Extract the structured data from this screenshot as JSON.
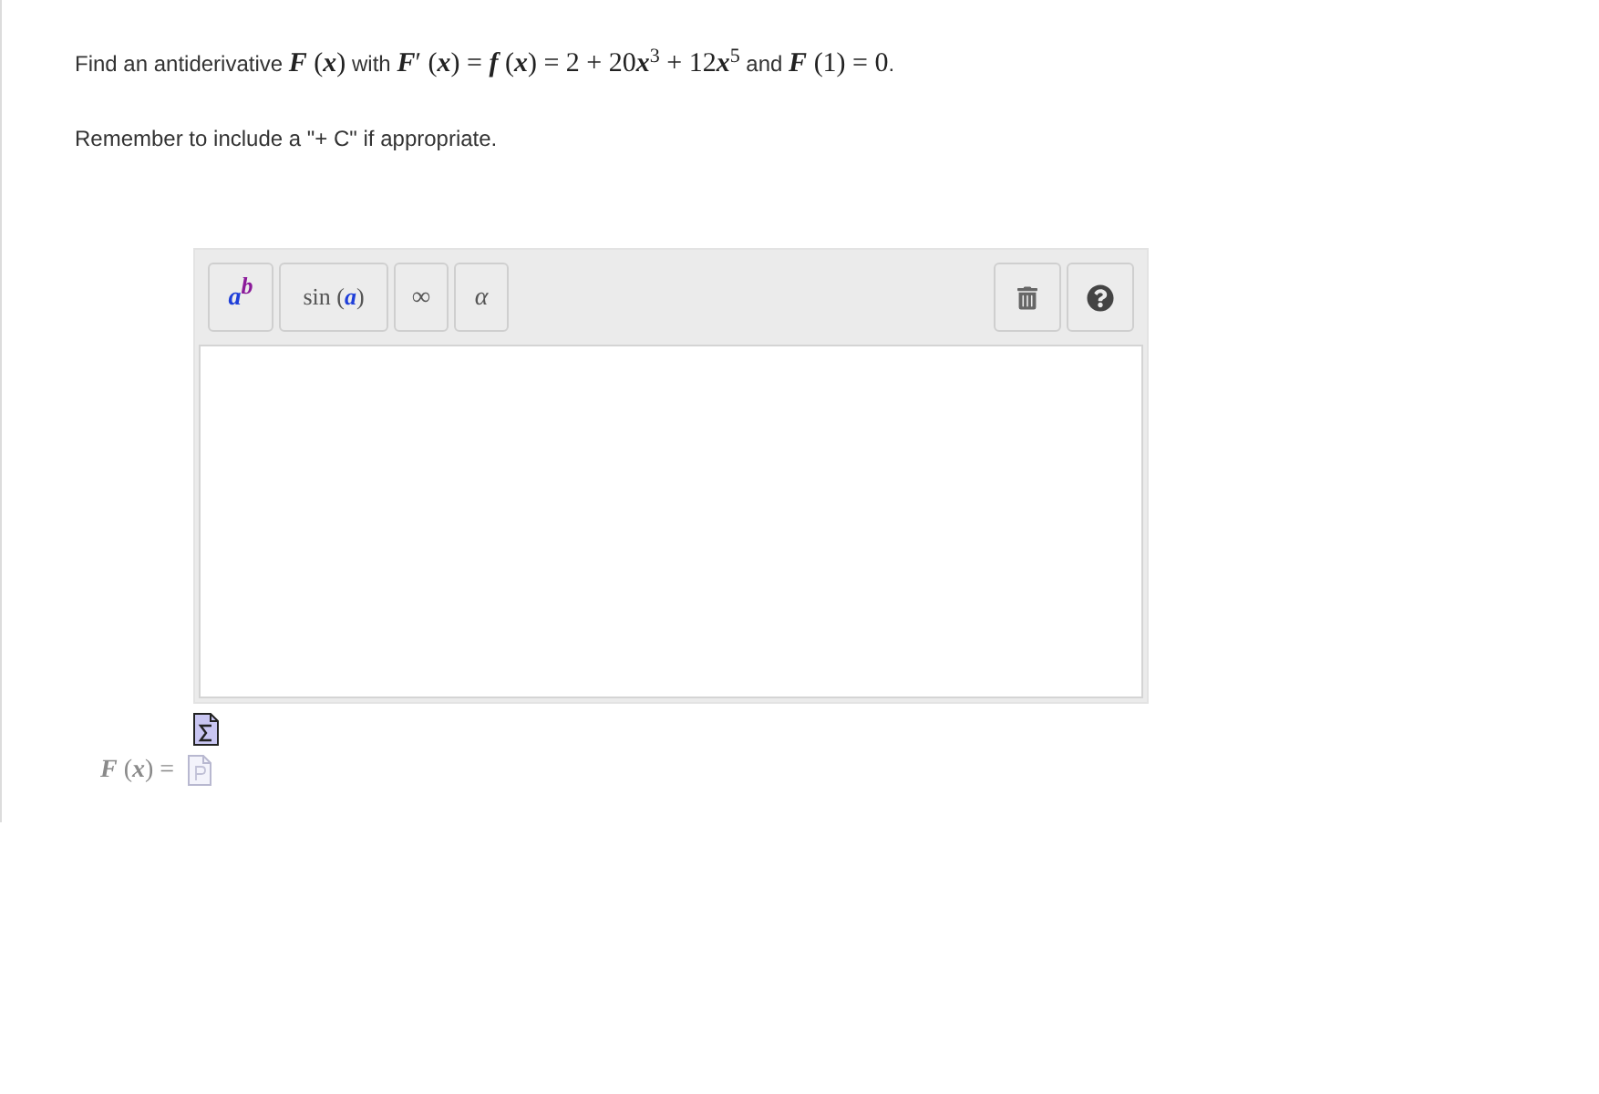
{
  "question": {
    "segments": [
      {
        "kind": "text",
        "text": "Find an antiderivative "
      },
      {
        "kind": "math",
        "text": "*F* (*x*)"
      },
      {
        "kind": "text",
        "text": " with "
      },
      {
        "kind": "math",
        "text": "*F*′ (*x*) = *f* (*x*) = 2 + 20"
      },
      {
        "kind": "math",
        "text": "*x*$^{3}$ + 12"
      },
      {
        "kind": "math",
        "text": "*x*$^{5}$"
      },
      {
        "kind": "text",
        "text": " and "
      },
      {
        "kind": "math",
        "text": "*F* (1) = 0"
      },
      {
        "kind": "text",
        "text": "."
      }
    ]
  },
  "note": "Remember to include a \"+ C\" if appropriate.",
  "toolbar": {
    "buttons": [
      {
        "kind": "power",
        "base": "a",
        "exponent": "b"
      },
      {
        "kind": "function",
        "text": "sin (*a*)"
      },
      {
        "kind": "symbol",
        "text": "∞"
      },
      {
        "kind": "symbol",
        "text": "α"
      }
    ]
  },
  "answer": {
    "label": "*F* (*x*) ="
  }
}
